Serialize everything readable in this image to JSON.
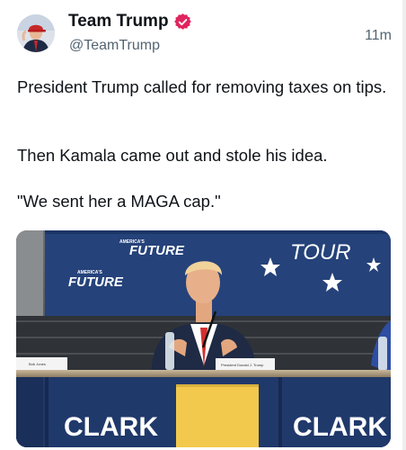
{
  "author": {
    "display_name": "Team Trump",
    "handle": "@TeamTrump",
    "avatar_icon": "avatar-photo-icon",
    "verified_icon": "verified-badge-icon",
    "verified_color": "#e0245e"
  },
  "timestamp": "11m",
  "tweet": {
    "paragraph_1": "President Trump called for removing taxes on tips.",
    "paragraph_2": "Then Kamala came out and stole his idea.",
    "paragraph_3": "\"We sent her a MAGA cap.\""
  },
  "media": {
    "banner_left_text": "FUTURE",
    "banner_left_small": "AMERICA'S",
    "banner_left_sub": "TOUR",
    "banner_right_text": "TOUR",
    "table_sign_left": "CLARK",
    "table_sign_right": "CLARK",
    "name_card_left": "Bob Jones",
    "name_card_center": "President Donald J. Trump",
    "accent_yellow": "#f2c94c",
    "banner_blue": "#25427a"
  }
}
